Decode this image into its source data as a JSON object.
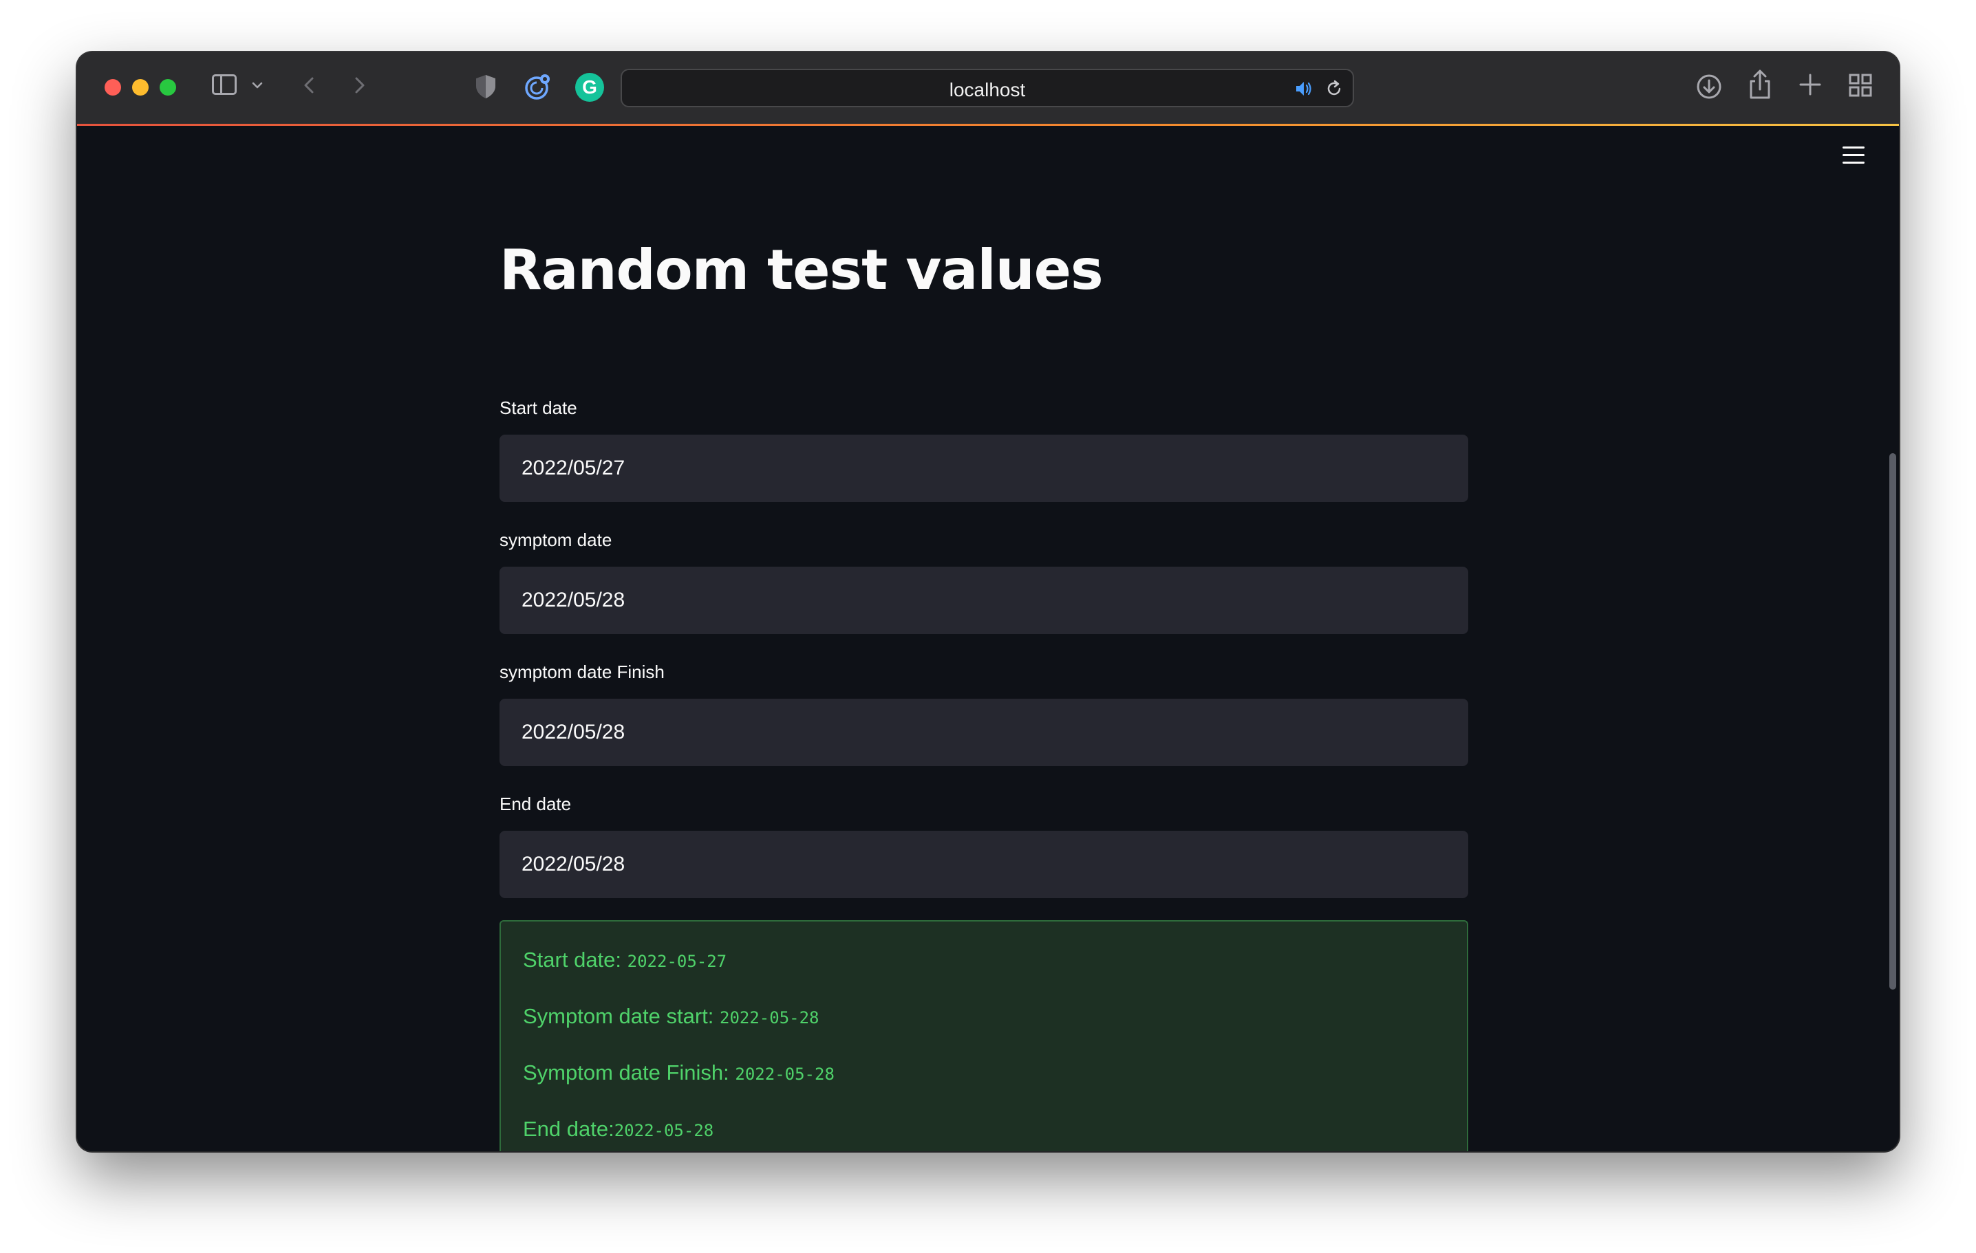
{
  "browser": {
    "url": "localhost",
    "icons": {
      "sidebar": "sidebar-icon",
      "tabs": "chevron-down-icon",
      "back": "chevron-left-icon",
      "forward": "chevron-right-icon",
      "privacy": "shield-icon",
      "extension1": "extension-icon",
      "extension2": "grammarly-icon",
      "audio": "speaker-icon",
      "reload": "reload-icon",
      "downloads": "download-icon",
      "share": "share-icon",
      "new_tab": "plus-icon",
      "tab_overview": "grid-icon"
    },
    "extension2_letter": "G"
  },
  "app": {
    "title": "Random test values",
    "menu_icon": "hamburger-icon",
    "fields": [
      {
        "label": "Start date",
        "value": "2022/05/27"
      },
      {
        "label": "symptom date",
        "value": "2022/05/28"
      },
      {
        "label": "symptom date Finish",
        "value": "2022/05/28"
      },
      {
        "label": "End date",
        "value": "2022/05/28"
      }
    ],
    "summary": [
      {
        "label": "Start date: ",
        "value": "2022-05-27"
      },
      {
        "label": "Symptom date start: ",
        "value": "2022-05-28"
      },
      {
        "label": "Symptom date Finish: ",
        "value": "2022-05-28"
      },
      {
        "label": "End date:",
        "value": "2022-05-28"
      }
    ]
  },
  "colors": {
    "background": "#0e1117",
    "input_bg": "#262730",
    "success_bg": "#1d3023",
    "success_text": "#4fd26a",
    "accent_start": "#e5533d",
    "accent_end": "#f6c344"
  }
}
